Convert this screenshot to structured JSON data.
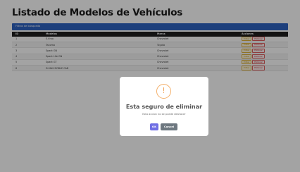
{
  "page": {
    "title": "Listado de Modelos de Vehículos",
    "filter_label": "Filtros de búsqueda"
  },
  "table": {
    "headers": [
      "ID",
      "Modelos",
      "Marca",
      "Acciones"
    ],
    "rows": [
      {
        "id": "1",
        "model": "E-Vroo",
        "brand": "Chevrolet",
        "edit": "Editar",
        "delete": "Eliminar"
      },
      {
        "id": "2",
        "model": "Tacoma",
        "brand": "Toyota",
        "edit": "Editar",
        "delete": "Eliminar"
      },
      {
        "id": "3",
        "model": "Spark GN",
        "brand": "Chevrolet",
        "edit": "Editar",
        "delete": "Eliminar"
      },
      {
        "id": "4",
        "model": "Spark Life GN",
        "brand": "Chevrolet",
        "edit": "Editar",
        "delete": "Eliminar"
      },
      {
        "id": "5",
        "model": "Spark GT",
        "brand": "Chevrolet",
        "edit": "Editar",
        "delete": "Eliminar"
      },
      {
        "id": "6",
        "model": "D-MAX DOBLE CAB",
        "brand": "Chevrolet",
        "edit": "Editar",
        "delete": "Eliminar"
      }
    ]
  },
  "dialog": {
    "icon": "warning-icon",
    "icon_glyph": "!",
    "title": "Esta seguro de eliminar",
    "text": "Esta accion no se puede deshacer",
    "ok_label": "OK",
    "cancel_label": "Cancel"
  },
  "colors": {
    "filter_bar": "#2e63c2",
    "header_bg": "#1f1f1f",
    "ok_button": "#6f6ee4",
    "cancel_button": "#6e7880",
    "warning": "#f4b06b"
  }
}
